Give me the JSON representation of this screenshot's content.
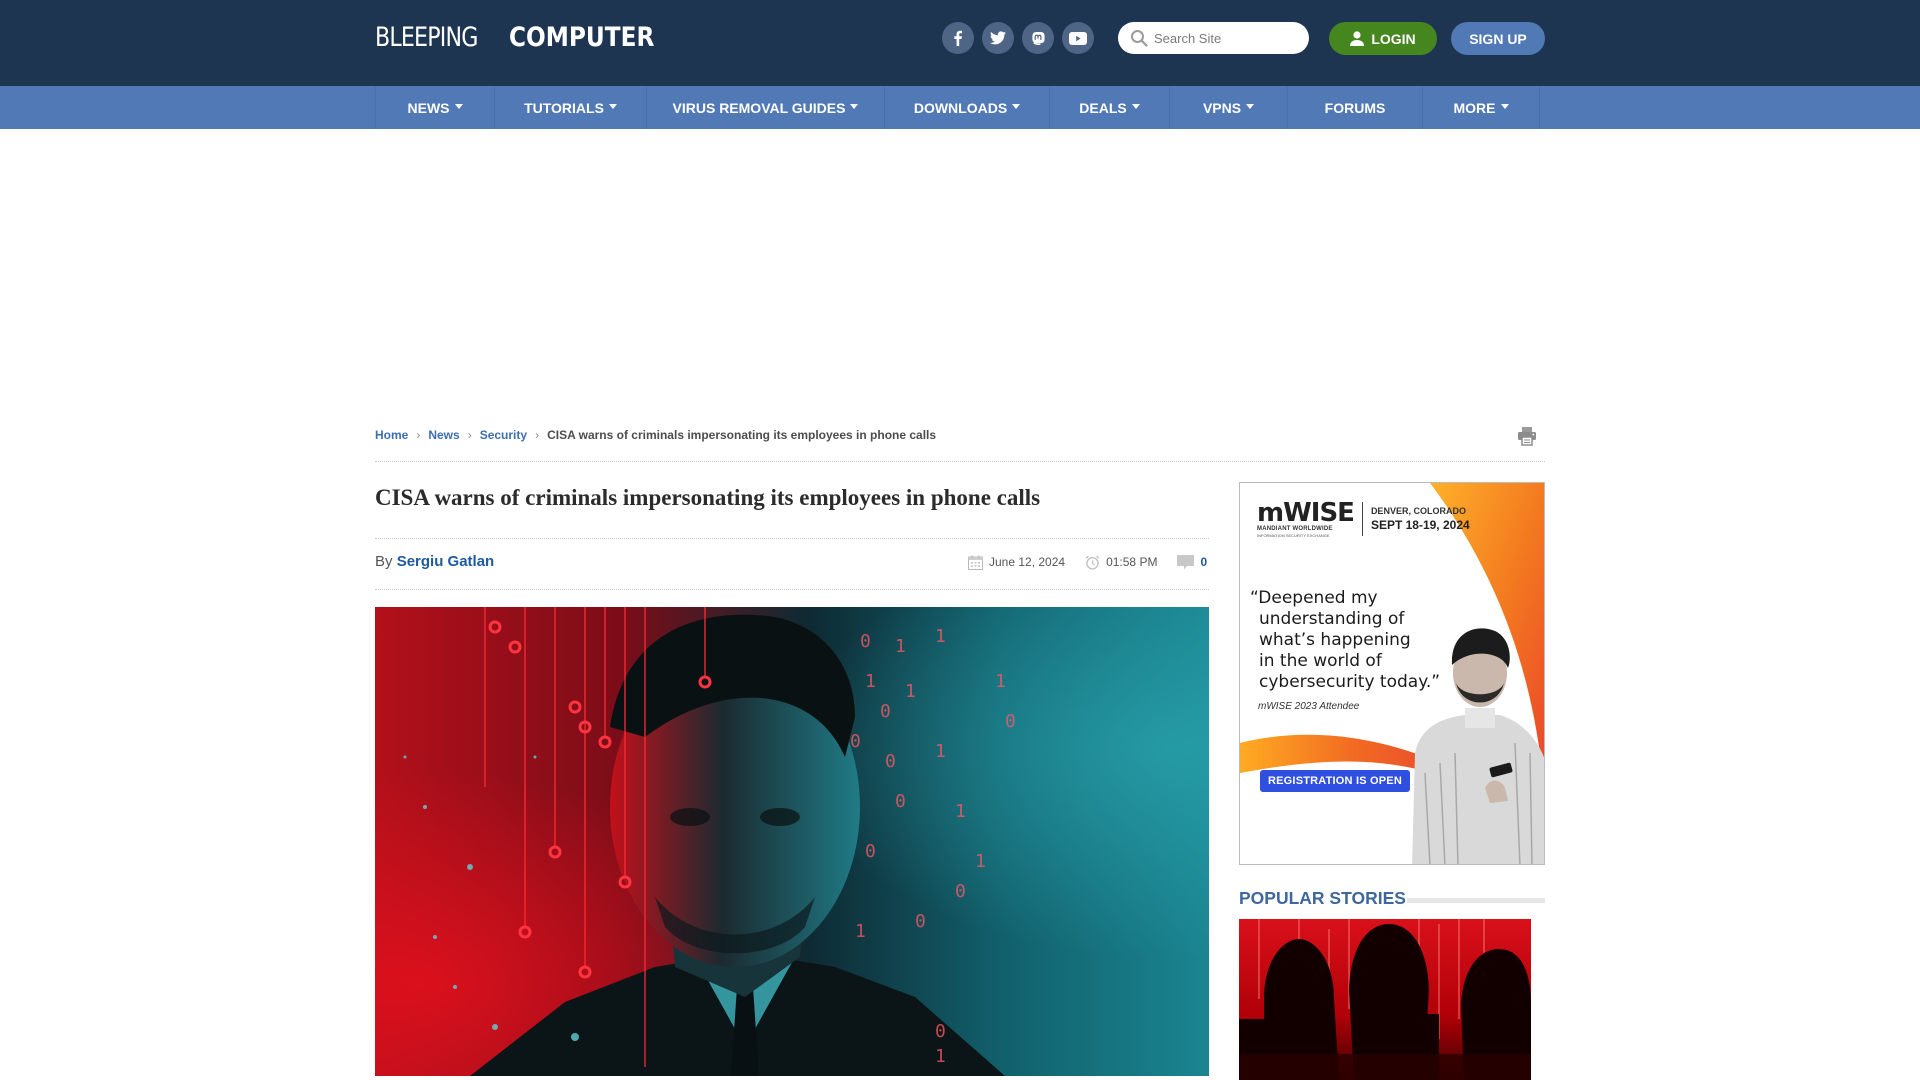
{
  "header": {
    "logo_light": "BLEEPING",
    "logo_bold": "COMPUTER",
    "social": [
      {
        "name": "facebook",
        "icon": "facebook-icon"
      },
      {
        "name": "twitter",
        "icon": "twitter-icon"
      },
      {
        "name": "mastodon",
        "icon": "mastodon-icon"
      },
      {
        "name": "youtube",
        "icon": "youtube-icon"
      }
    ],
    "search_placeholder": "Search Site",
    "search_value": "",
    "login_label": "LOGIN",
    "signup_label": "SIGN UP"
  },
  "nav": {
    "items": [
      {
        "label": "NEWS",
        "dropdown": true
      },
      {
        "label": "TUTORIALS",
        "dropdown": true
      },
      {
        "label": "VIRUS REMOVAL GUIDES",
        "dropdown": true
      },
      {
        "label": "DOWNLOADS",
        "dropdown": true
      },
      {
        "label": "DEALS",
        "dropdown": true
      },
      {
        "label": "VPNS",
        "dropdown": true
      },
      {
        "label": "FORUMS",
        "dropdown": false
      },
      {
        "label": "MORE",
        "dropdown": true
      }
    ]
  },
  "breadcrumb": {
    "items": [
      "Home",
      "News",
      "Security"
    ],
    "current": "CISA warns of criminals impersonating its employees in phone calls"
  },
  "article": {
    "title": "CISA warns of criminals impersonating its employees in phone calls",
    "by_label": "By",
    "author": "Sergiu Gatlan",
    "date": "June 12, 2024",
    "time": "01:58 PM",
    "comments": "0"
  },
  "ad": {
    "brand": "mWISE",
    "brand_sub": "MANDIANT WORLDWIDE",
    "brand_sub2": "INFORMATION SECURITY EXCHANGE",
    "location": "DENVER, COLORADO",
    "dates": "SEPT 18-19, 2024",
    "quote_lines": [
      "“Deepened my",
      "understanding of",
      "what’s happening",
      "in the world of",
      "cybersecurity today.”"
    ],
    "attribution": "mWISE 2023 Attendee",
    "cta": "REGISTRATION IS OPEN"
  },
  "sidebar": {
    "popular_heading": "POPULAR STORIES"
  },
  "colors": {
    "header_bg": "#1e3552",
    "nav_bg": "#5079b6",
    "login_green": "#46861f",
    "link_blue": "#1d5a9f",
    "popular_heading": "#3e679f"
  }
}
